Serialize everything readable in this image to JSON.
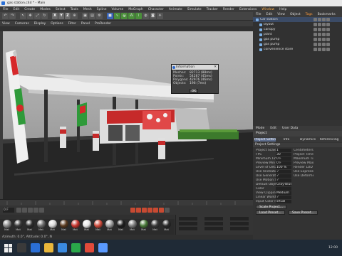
{
  "window": {
    "title": "gas station.c4d * - Main"
  },
  "menubar": [
    "File",
    "Edit",
    "Create",
    "Modes",
    "Select",
    "Tools",
    "Mesh",
    "Spline",
    "Volume",
    "MoGraph",
    "Character",
    "Animate",
    "Simulate",
    "Tracker",
    "Render",
    "Extensions",
    "Window",
    "Help"
  ],
  "subtabs": [
    "View",
    "Cameras",
    "Display",
    "Options",
    "Filter",
    "Panel",
    "ProRender"
  ],
  "viewport": {
    "label": "Perspective",
    "grid_spacing": "Grid Spacing : 10000 cm"
  },
  "info_dialog": {
    "title": "Information",
    "rows": [
      {
        "k": "Meshes:",
        "v": "82713 (88ms)"
      },
      {
        "k": "Points:",
        "v": "54267 (45ms)"
      },
      {
        "k": "Polygons:",
        "v": "42976 (46ms)"
      },
      {
        "k": "Objects:",
        "v": "196 (7ms)"
      }
    ],
    "ok": "OK"
  },
  "timeline": {
    "frame": "0 F"
  },
  "materials": [
    {
      "name": "Mat",
      "color": "#8a8a8a"
    },
    {
      "name": "Mat",
      "color": "#3a3a3a"
    },
    {
      "name": "Mat",
      "color": "#2e2e2e"
    },
    {
      "name": "Mat",
      "color": "#6a6a6a"
    },
    {
      "name": "Mat",
      "color": "#d8d8d8"
    },
    {
      "name": "Mat",
      "color": "#5a3a1e"
    },
    {
      "name": "Mat",
      "color": "#c8332c"
    },
    {
      "name": "Mat",
      "color": "#e6e6e6"
    },
    {
      "name": "Mat",
      "color": "#d04a3a"
    },
    {
      "name": "Mat",
      "color": "#9a9a9a"
    },
    {
      "name": "Mat",
      "color": "#1e1e1e"
    },
    {
      "name": "Mat",
      "color": "#7c7c7c"
    },
    {
      "name": "Mat",
      "color": "#4a7a3a"
    },
    {
      "name": "Mat",
      "color": "#3a3a3a"
    },
    {
      "name": "Mat",
      "color": "#2a2a2a"
    }
  ],
  "statusbar": "Azimuth: 0.0°, Altitude: 0.0°, N",
  "object_manager": {
    "menu": [
      "File",
      "Edit",
      "View",
      "Object",
      "Tags",
      "Bookmarks"
    ],
    "objects": [
      "Car station",
      "layout",
      "canopy",
      "plant",
      "gas pump",
      "gas pump",
      "convenience store"
    ]
  },
  "attributes": {
    "menu": [
      "Mode",
      "Edit",
      "User Data"
    ],
    "header": "Project",
    "tabs": [
      "Project Settings",
      "Info",
      "Dynamics",
      "Referencing"
    ],
    "section": "Project Settings",
    "rows": [
      {
        "l": "Project Scale",
        "v": "1",
        "l2": "Centimeters"
      },
      {
        "l": "FPS",
        "v": "30",
        "l2": "Project Time"
      },
      {
        "l": "Minimum Time",
        "v": "0 F",
        "l2": "Maximum Time"
      },
      {
        "l": "Preview Min Time",
        "v": "0 F",
        "l2": "Preview Max Time"
      },
      {
        "l": "Level of Detail",
        "v": "100 %",
        "l2": "Render LOD in Editor"
      },
      {
        "l": "Use Animation",
        "v": "✓",
        "l2": "Use Expression"
      },
      {
        "l": "Use Generators",
        "v": "✓",
        "l2": "Use Deformers"
      },
      {
        "l": "Use Motion System",
        "v": "✓",
        "l2": ""
      },
      {
        "l": "Default Object Color",
        "v": "Gray-Blue",
        "l2": ""
      },
      {
        "l": "Color",
        "v": "",
        "l2": ""
      },
      {
        "l": "View Clipping",
        "v": "Medium",
        "l2": ""
      },
      {
        "l": "Linear Workflow",
        "v": "✓",
        "l2": ""
      },
      {
        "l": "Input Color Profile",
        "v": "sRGB",
        "l2": ""
      }
    ],
    "scale_button": "Scale Project...",
    "load_button": "Load Preset...",
    "save_button": "Save Preset..."
  },
  "taskbar": {
    "clock": "12:00"
  }
}
